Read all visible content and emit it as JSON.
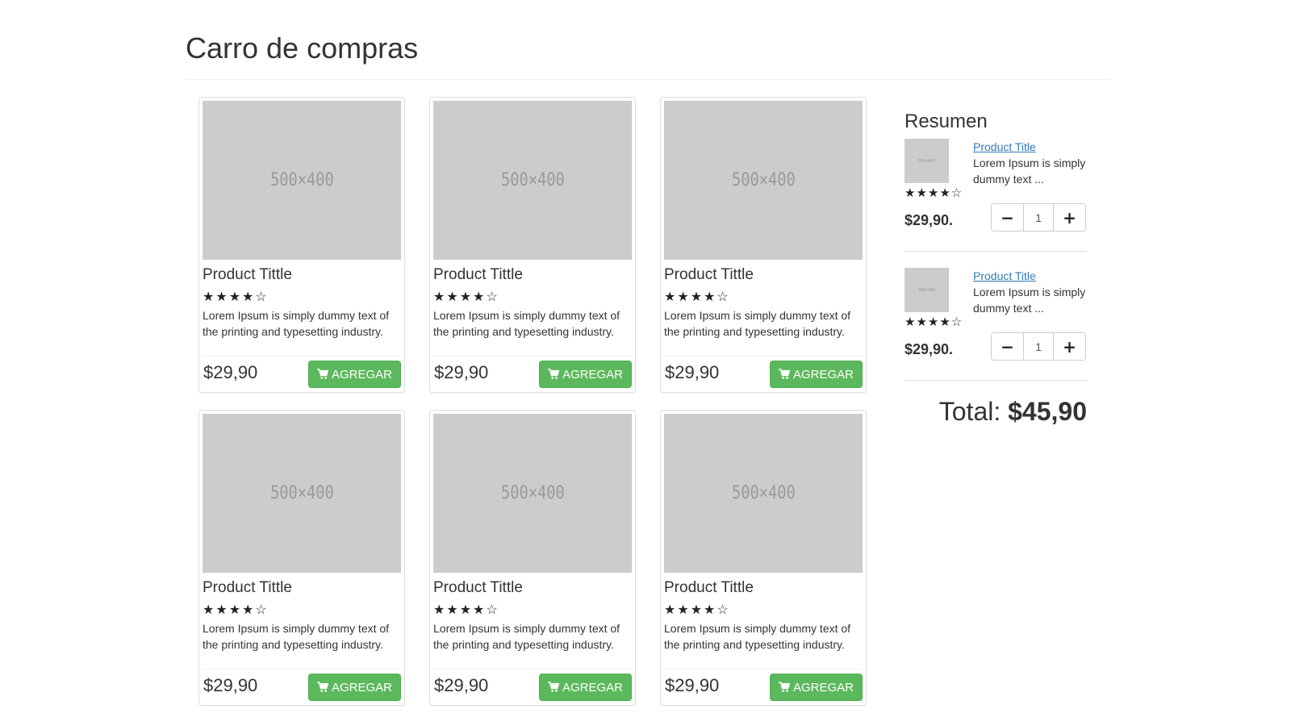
{
  "page": {
    "title": "Carro de compras"
  },
  "products": [
    {
      "image_label": "500×400",
      "title": "Product Tittle",
      "rating": 4,
      "max_rating": 5,
      "stars": "★★★★☆",
      "description": "Lorem Ipsum is simply dummy text of the printing and typesetting industry.",
      "price": "$29,90",
      "button_label": "AGREGAR"
    },
    {
      "image_label": "500×400",
      "title": "Product Tittle",
      "rating": 4,
      "max_rating": 5,
      "stars": "★★★★☆",
      "description": "Lorem Ipsum is simply dummy text of the printing and typesetting industry.",
      "price": "$29,90",
      "button_label": "AGREGAR"
    },
    {
      "image_label": "500×400",
      "title": "Product Tittle",
      "rating": 4,
      "max_rating": 5,
      "stars": "★★★★☆",
      "description": "Lorem Ipsum is simply dummy text of the printing and typesetting industry.",
      "price": "$29,90",
      "button_label": "AGREGAR"
    },
    {
      "image_label": "500×400",
      "title": "Product Tittle",
      "rating": 4,
      "max_rating": 5,
      "stars": "★★★★☆",
      "description": "Lorem Ipsum is simply dummy text of the printing and typesetting industry.",
      "price": "$29,90",
      "button_label": "AGREGAR"
    },
    {
      "image_label": "500×400",
      "title": "Product Tittle",
      "rating": 4,
      "max_rating": 5,
      "stars": "★★★★☆",
      "description": "Lorem Ipsum is simply dummy text of the printing and typesetting industry.",
      "price": "$29,90",
      "button_label": "AGREGAR"
    },
    {
      "image_label": "500×400",
      "title": "Product Tittle",
      "rating": 4,
      "max_rating": 5,
      "stars": "★★★★☆",
      "description": "Lorem Ipsum is simply dummy text of the printing and typesetting industry.",
      "price": "$29,90",
      "button_label": "AGREGAR"
    }
  ],
  "summary": {
    "title": "Resumen",
    "items": [
      {
        "image_label": "500×400",
        "title": "Product Title",
        "description": "Lorem Ipsum is simply dummy text ...",
        "rating": 4,
        "stars": "★★★★☆",
        "price": "$29,90.",
        "quantity": "1",
        "minus": "−",
        "plus": "+"
      },
      {
        "image_label": "500×400",
        "title": "Product Title",
        "description": "Lorem Ipsum is simply dummy text ...",
        "rating": 4,
        "stars": "★★★★☆",
        "price": "$29,90.",
        "quantity": "1",
        "minus": "−",
        "plus": "+"
      }
    ],
    "total_label": "Total:",
    "total_value": "$45,90"
  },
  "icons": {
    "cart": "shopping-cart-icon"
  },
  "colors": {
    "button_green": "#5cb85c",
    "link_blue": "#337ab7",
    "placeholder_gray": "#cccccc"
  }
}
